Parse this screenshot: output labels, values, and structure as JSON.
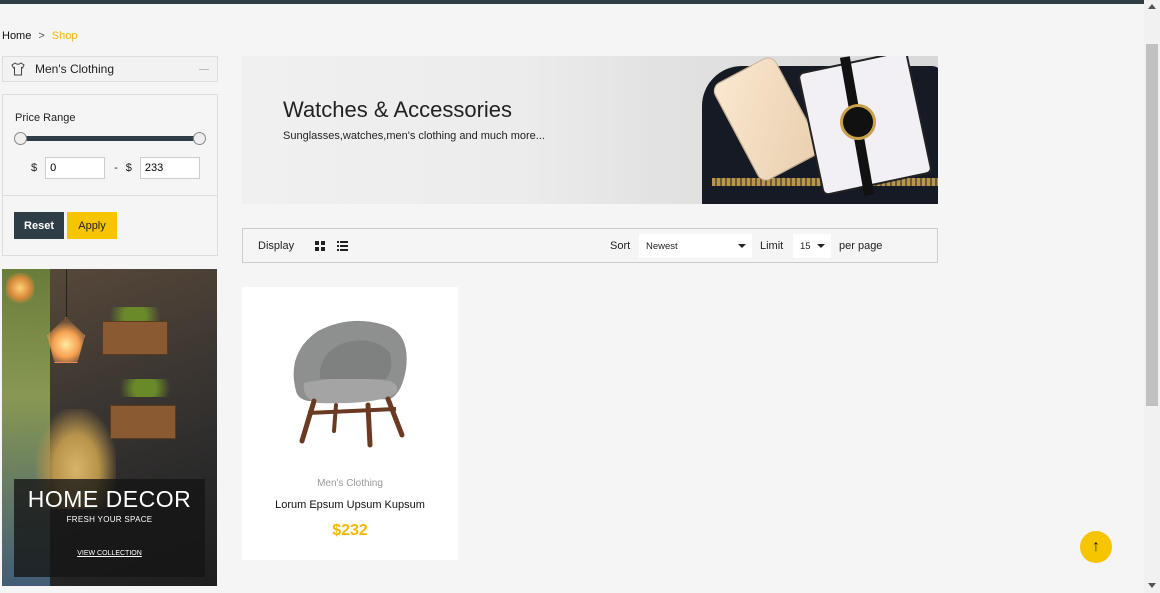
{
  "breadcrumb": {
    "home": "Home",
    "separator": ">",
    "current": "Shop"
  },
  "sidebar": {
    "category": {
      "label": "Men's Clothing",
      "icon": "shirt-icon"
    },
    "price_range": {
      "title": "Price Range",
      "currency": "$",
      "min_value": "0",
      "max_value": "233",
      "dash": "-",
      "reset_label": "Reset",
      "apply_label": "Apply"
    },
    "promo": {
      "heading": "HOME DECOR",
      "subheading": "FRESH YOUR SPACE",
      "link": "VIEW COLLECTION"
    }
  },
  "banner": {
    "title": "Watches & Accessories",
    "subtitle": "Sunglasses,watches,men's clothing and much more..."
  },
  "toolbar": {
    "display_label": "Display",
    "sort_label": "Sort",
    "sort_value": "Newest",
    "limit_label": "Limit",
    "limit_value": "15",
    "per_page_label": "per page"
  },
  "products": [
    {
      "category": "Men's Clothing",
      "name": "Lorum Epsum Upsum Kupsum",
      "price": "$232"
    }
  ],
  "back_to_top": "↑",
  "colors": {
    "accent": "#f5b800",
    "dark": "#2f3e46"
  }
}
